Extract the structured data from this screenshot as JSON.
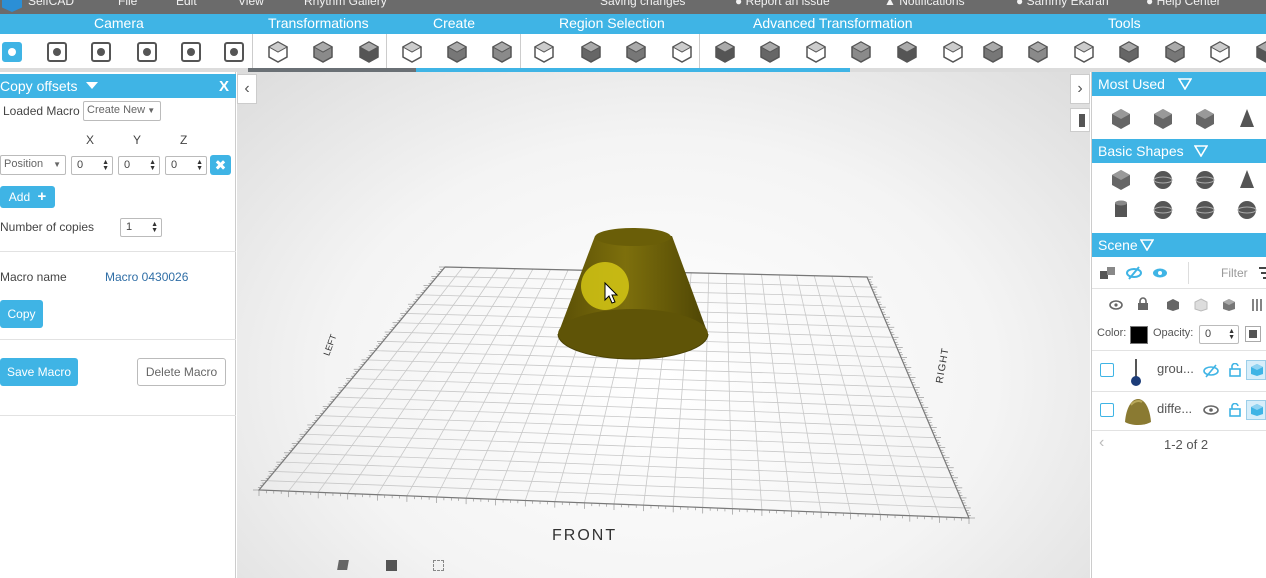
{
  "menu": {
    "app_name": "SelfCAD",
    "items": [
      "File",
      "Edit",
      "View",
      "Rhythm Gallery"
    ],
    "status": "Saving changes",
    "report": "Report an issue",
    "notifications": "Notifications",
    "user": "Sammy Ekaran",
    "help": "Help Center"
  },
  "categories": [
    "Camera",
    "Transformations",
    "Create",
    "Region Selection",
    "Advanced Transformation",
    "Tools"
  ],
  "toolbar": {
    "icons": [
      "camera-3d-view-icon",
      "zoom-selection-icon",
      "pan-hand-icon",
      "rotate-view-icon",
      "camera-settings-icon",
      "screenshot-icon",
      "move-tool-icon",
      "scale-tool-icon",
      "rotate-tool-icon",
      "shapes-cube-icon",
      "shape-generator-icon",
      "box-icon",
      "region-select-icon",
      "face-select-icon",
      "edge-select-icon",
      "vertex-select-icon",
      "extrude-icon",
      "bevel-icon",
      "loop-cut-icon",
      "taper-icon",
      "twist-icon",
      "bend-icon",
      "mirror-icon",
      "boolean-icon",
      "stitch-icon",
      "sculpt-icon",
      "smooth-icon",
      "simplify-icon",
      "more-tools-icon"
    ],
    "progress": 0.51
  },
  "left_panel": {
    "title": "Copy offsets",
    "close_label": "X",
    "loaded_macro_label": "Loaded Macro",
    "loaded_macro_value": "Create New",
    "axes": [
      "X",
      "Y",
      "Z"
    ],
    "offset_type": "Position",
    "offset_values": [
      "0",
      "0",
      "0"
    ],
    "add_label": "Add",
    "copies_label": "Number of copies",
    "copies_value": "1",
    "macro_name_label": "Macro name",
    "macro_name_value": "Macro 0430026",
    "copy_label": "Copy",
    "save_macro_label": "Save Macro",
    "delete_macro_label": "Delete Macro"
  },
  "viewport": {
    "grid_labels": {
      "front": "FRONT",
      "left": "LEFT",
      "right": "RIGHT"
    },
    "object_color": "#7d6f0c",
    "cursor_highlight": "#d9cc15"
  },
  "right_panel": {
    "most_used_title": "Most Used",
    "most_used_icons": [
      "move-tool-icon",
      "scale-tool-icon",
      "rotate-tool-icon",
      "paint-icon"
    ],
    "basic_shapes_title": "Basic Shapes",
    "basic_shapes_icons": [
      "cube-icon",
      "torus-icon",
      "sphere-icon",
      "cone-icon",
      "cylinder-icon",
      "torus-knot-icon",
      "icosahedron-icon",
      "dodecahedron-icon"
    ],
    "scene_title": "Scene",
    "filter_placeholder": "Filter",
    "color_label": "Color:",
    "opacity_label": "Opacity:",
    "opacity_value": "0",
    "swatch_color": "#000000",
    "items": [
      {
        "name": "grou...",
        "icon": "group-icon"
      },
      {
        "name": "diffe...",
        "icon": "difference-shape-icon"
      }
    ],
    "pager": "1-2 of 2"
  },
  "accent": "#3fb4e5"
}
